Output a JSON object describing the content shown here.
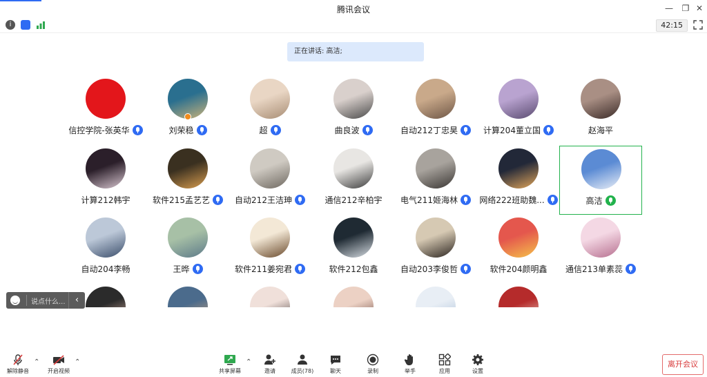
{
  "window": {
    "title": "腾讯会议"
  },
  "status": {
    "timer": "42:15"
  },
  "speaking": {
    "text": "正在讲话: 高洁;"
  },
  "participants": [
    {
      "name": "信控学院-张英华",
      "mic": "blue"
    },
    {
      "name": "刘荣稳",
      "mic": "blue",
      "host_badge": true
    },
    {
      "name": "超",
      "mic": "blue"
    },
    {
      "name": "曲良波",
      "mic": "blue"
    },
    {
      "name": "自动212丁忠昊",
      "mic": "blue"
    },
    {
      "name": "计算204董立国",
      "mic": "blue"
    },
    {
      "name": "赵海平",
      "mic": "none"
    },
    {
      "name": "计算212韩宇",
      "mic": "none"
    },
    {
      "name": "软件215孟艺艺",
      "mic": "blue"
    },
    {
      "name": "自动212王洁珅",
      "mic": "blue"
    },
    {
      "name": "通信212辛柏宇",
      "mic": "none"
    },
    {
      "name": "电气211姬海林",
      "mic": "blue"
    },
    {
      "name": "网络222班助魏...",
      "mic": "blue"
    },
    {
      "name": "高洁",
      "mic": "green",
      "active": true
    },
    {
      "name": "自动204李畅",
      "mic": "none"
    },
    {
      "name": "王晔",
      "mic": "blue"
    },
    {
      "name": "软件211姜宛君",
      "mic": "blue"
    },
    {
      "name": "软件212包鑫",
      "mic": "none"
    },
    {
      "name": "自动203李俊哲",
      "mic": "blue"
    },
    {
      "name": "软件204颜明鑫",
      "mic": "none"
    },
    {
      "name": "通信213单素蕊",
      "mic": "blue"
    }
  ],
  "chat": {
    "placeholder": "说点什么..."
  },
  "toolbar": {
    "unmute": "解除静音",
    "video": "开启视频",
    "share": "共享屏幕",
    "invite": "邀请",
    "members": "成员(78)",
    "chat": "聊天",
    "record": "录制",
    "raise_hand": "举手",
    "apps": "应用",
    "settings": "设置",
    "leave": "离开会议"
  },
  "colors": {
    "accent": "#2f6bf3",
    "active_speaker": "#22b24c",
    "leave": "#d83b3b"
  }
}
